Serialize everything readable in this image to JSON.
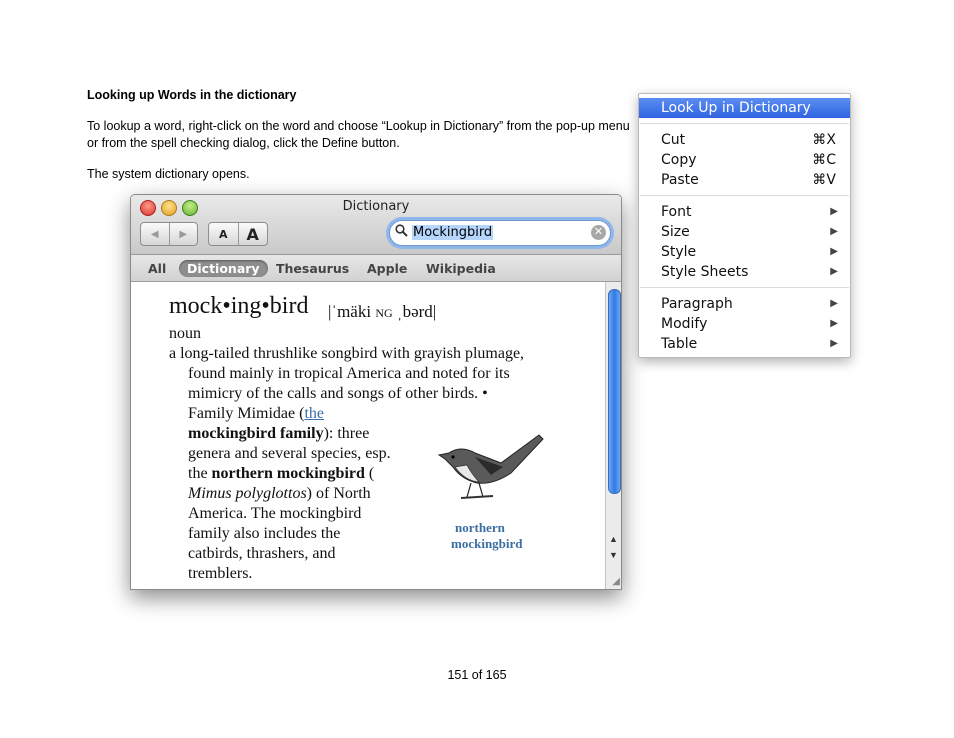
{
  "document": {
    "heading": "Looking up Words in the dictionary",
    "paragraph1": "To lookup a word, right-click on the word and choose “Lookup in Dictionary” from the pop-up menu or from the spell checking dialog, click the Define button.",
    "paragraph2": "The system dictionary opens.",
    "footer": "151 of 165"
  },
  "dictionary_window": {
    "title": "Dictionary",
    "font_small": "A",
    "font_large": "A",
    "search_value": "Mockingbird",
    "scopes": [
      "All",
      "Dictionary",
      "Thesaurus",
      "Apple",
      "Wikipedia"
    ],
    "selected_scope": "Dictionary",
    "entry": {
      "headword": "mock•ing•bird",
      "pron_part1": "|ˈmäki",
      "pron_part2": "NG",
      "pron_part3": "ˌbərd|",
      "part_of_speech": "noun",
      "def_line1": "a long-tailed thrushlike songbird with grayish plumage,",
      "def_line2": "found mainly in tropical America and noted for its",
      "def_line3": "mimicry of the calls and songs of other birds. •",
      "def_line4_a": "Family Mimidae (",
      "def_line4_link": "the",
      "def_line5_bold": "mockingbird family",
      "def_line5_rest": "): three",
      "def_line6": "genera and several species, esp.",
      "def_line7_a": "the ",
      "def_line7_bold": "northern mockingbird",
      "def_line7_rest": " (",
      "def_line8_italic": "Mimus polyglottos",
      "def_line8_rest": ") of North",
      "def_line9": "America. The mockingbird",
      "def_line10": "family also includes the",
      "def_line11": "catbirds, thrashers, and",
      "def_line12": "tremblers.",
      "image_caption_1": "northern",
      "image_caption_2": "mockingbird"
    }
  },
  "context_menu": {
    "highlighted": "Look Up in Dictionary",
    "items_group1": [
      {
        "label": "Cut",
        "shortcut": "⌘X"
      },
      {
        "label": "Copy",
        "shortcut": "⌘C"
      },
      {
        "label": "Paste",
        "shortcut": "⌘V"
      }
    ],
    "items_group2": [
      "Font",
      "Size",
      "Style",
      "Style Sheets"
    ],
    "items_group3": [
      "Paragraph",
      "Modify",
      "Table"
    ],
    "submenu_arrow": "▶"
  },
  "colors": {
    "menu_highlight": "#3a6fe6",
    "link": "#3a6fa8",
    "scroll_thumb": "#2f7ae6"
  }
}
